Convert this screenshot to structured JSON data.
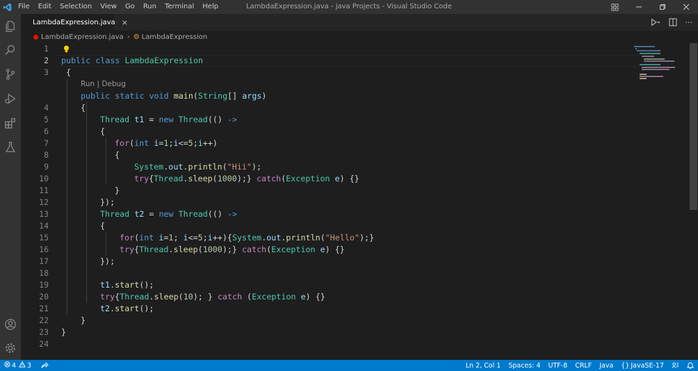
{
  "window": {
    "title": "LambdaExpression.java - java Projects - Visual Studio Code",
    "menu": [
      "File",
      "Edit",
      "Selection",
      "View",
      "Go",
      "Run",
      "Terminal",
      "Help"
    ]
  },
  "tab": {
    "label": "LambdaExpression.java",
    "close": "×"
  },
  "breadcrumb": {
    "file": "LambdaExpression.java",
    "separator": "›",
    "symbol": "LambdaExpression"
  },
  "codelens": "Run | Debug",
  "line_numbers": [
    "1",
    "2",
    "3",
    "4",
    "5",
    "6",
    "7",
    "8",
    "9",
    "10",
    "11",
    "12",
    "13",
    "14",
    "15",
    "16",
    "17",
    "18",
    "19",
    "20",
    "21",
    "22",
    "23",
    "24"
  ],
  "active_line": "2",
  "code": {
    "l2": {
      "kw": "public class ",
      "name": "LambdaExpression"
    },
    "l3": {
      "brace": "{"
    },
    "l4": {
      "kw": "public static void ",
      "fn": "main",
      "open": "(",
      "type": "String",
      "rest": "[] ",
      "param": "args",
      "close": ")"
    },
    "l5": {
      "brace": "{"
    },
    "l6": {
      "type": "Thread ",
      "var": "t1",
      "eq": " = ",
      "kw": "new ",
      "type2": "Thread",
      "rest": "(() ",
      "arrow": "->"
    },
    "l7": {
      "brace": "{"
    },
    "l8": {
      "kw": "for",
      "open": "(",
      "type": "int ",
      "var": "i",
      "eq": "=",
      "n1": "1",
      "semi": ";",
      "var2": "i",
      "le": "<=",
      "n2": "5",
      "semi2": ";",
      "var3": "i",
      "inc": "++)"
    },
    "l9": {
      "brace": "{"
    },
    "l10": {
      "cls": "System",
      "dot": ".",
      "fld": "out",
      "dot2": ".",
      "fn": "println",
      "open": "(",
      "str": "\"Hii\"",
      "close": ");"
    },
    "l11": {
      "kw": "try",
      "ob": "{",
      "cls": "Thread",
      "dot": ".",
      "fn": "sleep",
      "open": "(",
      "num": "1000",
      "close": ");} ",
      "kw2": "catch",
      "open2": "(",
      "exc": "Exception ",
      "var": "e",
      "close2": ") {}"
    },
    "l12": {
      "brace": "}"
    },
    "l13": {
      "brace": "});"
    },
    "l14": {
      "type": "Thread ",
      "var": "t2",
      "eq": " = ",
      "kw": "new ",
      "type2": "Thread",
      "rest": "(() ",
      "arrow": "->"
    },
    "l15": {
      "brace": "{"
    },
    "l16": {
      "kw": "for",
      "open": "(",
      "type": "int ",
      "var": "i",
      "eq": "=",
      "n1": "1",
      "semi": "; ",
      "var2": "i",
      "le": "<=",
      "n2": "5",
      "semi2": ";",
      "var3": "i",
      "inc": "++){",
      "cls": "System",
      "dot": ".",
      "fld": "out",
      "dot2": ".",
      "fn": "println",
      "open2": "(",
      "str": "\"Hello\"",
      "close": ");}"
    },
    "l17": {
      "kw": "try",
      "ob": "{",
      "cls": "Thread",
      "dot": ".",
      "fn": "sleep",
      "open": "(",
      "num": "1000",
      "close": ");} ",
      "kw2": "catch",
      "open2": "(",
      "exc": "Exception ",
      "var": "e",
      "close2": ") {}"
    },
    "l18": {
      "brace": "});"
    },
    "l20": {
      "var": "t1",
      "dot": ".",
      "fn": "start",
      "rest": "();"
    },
    "l21": {
      "kw": "try",
      "ob": "{",
      "cls": "Thread",
      "dot": ".",
      "fn": "sleep",
      "open": "(",
      "num": "10",
      "close": "); } ",
      "kw2": "catch",
      "sp": " (",
      "exc": "Exception ",
      "var": "e",
      "close2": ") {}"
    },
    "l22": {
      "var": "t2",
      "dot": ".",
      "fn": "start",
      "rest": "();"
    },
    "l23": {
      "brace": "}"
    },
    "l24": {
      "brace": "}"
    }
  },
  "status": {
    "errors": "4",
    "warnings": "3",
    "position": "Ln 2, Col 1",
    "spaces": "Spaces: 4",
    "encoding": "UTF-8",
    "eol": "CRLF",
    "language": "Java",
    "jdk": "JavaSE-17"
  },
  "colors": {
    "accent": "#007acc",
    "error_dot": "#e51400"
  }
}
